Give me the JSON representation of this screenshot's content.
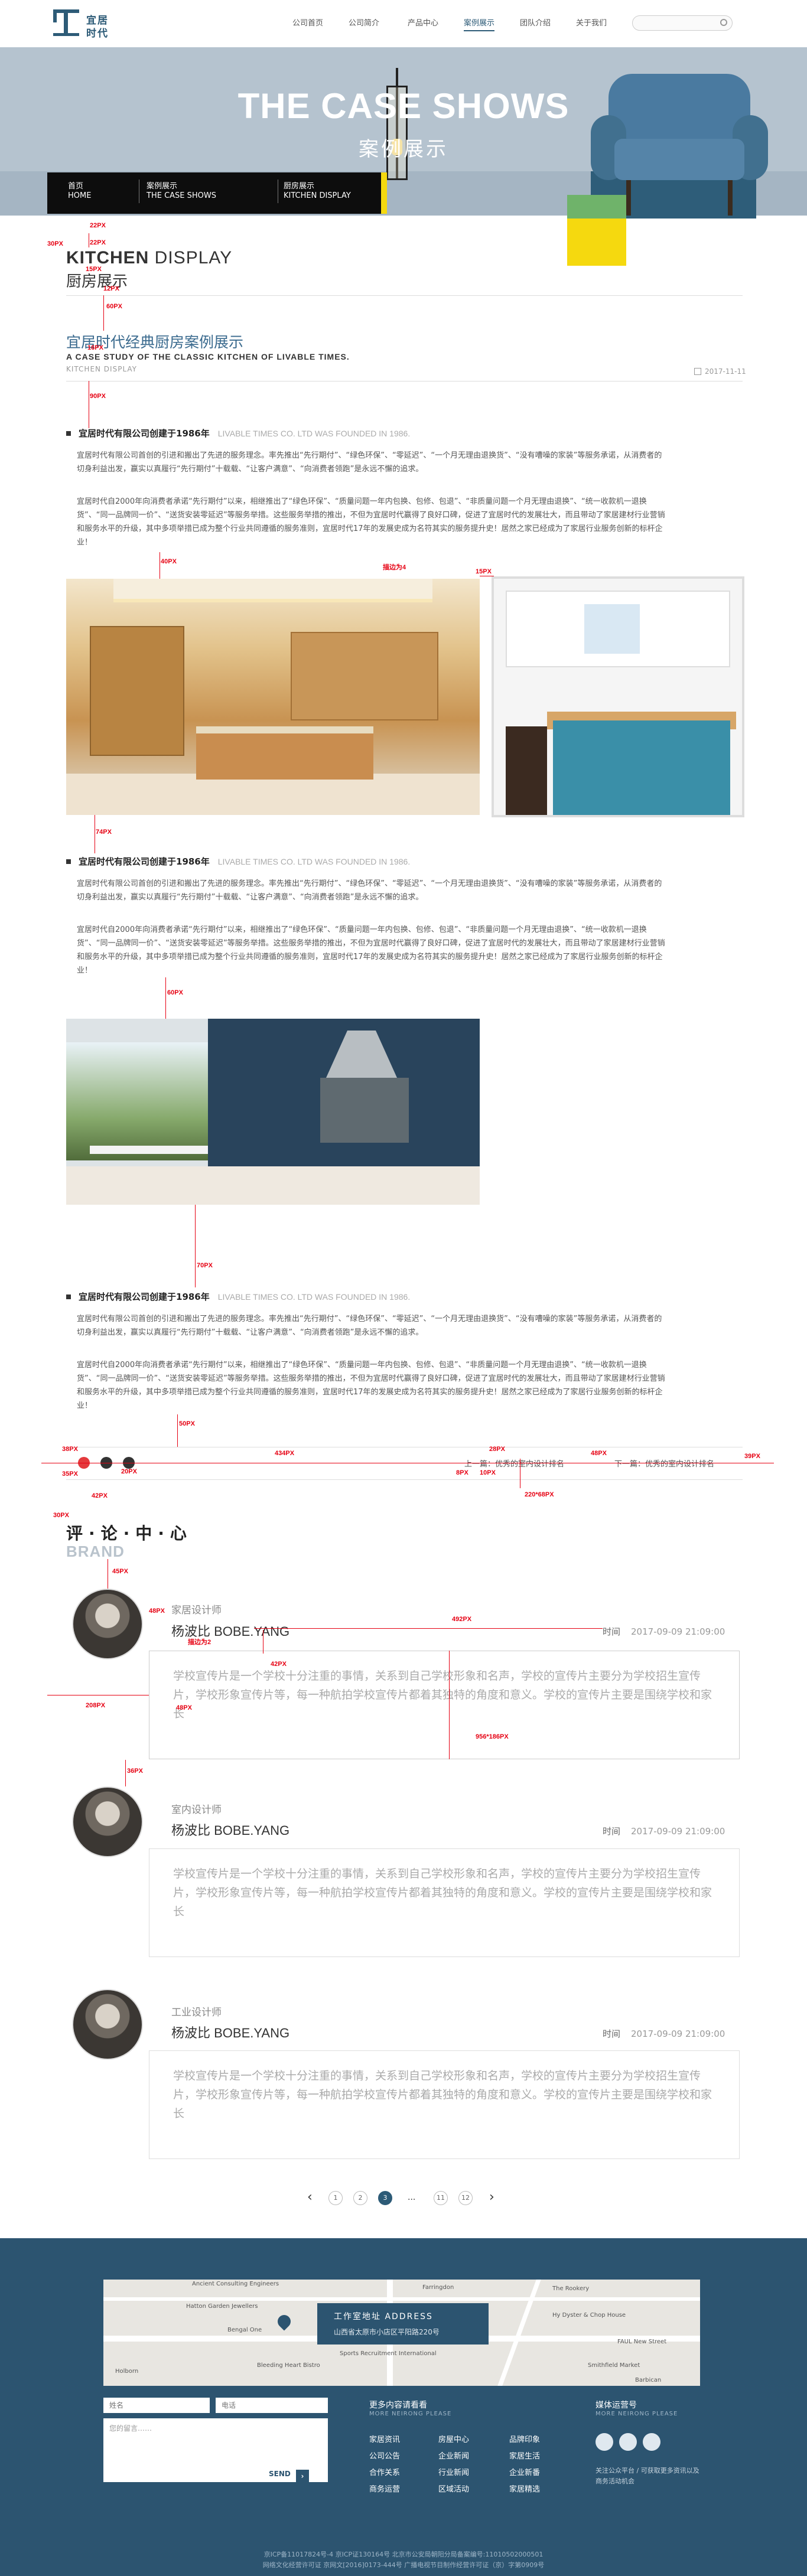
{
  "header": {
    "logo_line1": "宜居",
    "logo_line2": "时代",
    "nav": [
      "公司首页",
      "公司简介",
      "产品中心",
      "案例展示",
      "团队介绍",
      "关于我们"
    ],
    "search_placeholder": ""
  },
  "banner": {
    "title_en": "THE CASE SHOWS",
    "title_cn": "案例展示"
  },
  "breadcrumb": [
    {
      "cn": "首页",
      "en": "HOME"
    },
    {
      "cn": "案例展示",
      "en": "THE CASE SHOWS"
    },
    {
      "cn": "厨房展示",
      "en": "KITCHEN DISPLAY"
    }
  ],
  "section": {
    "title_bold": "KITCHEN",
    "title_light": " DISPLAY",
    "title_cn": "厨房展示"
  },
  "article": {
    "title": "宜居时代经典厨房案例展示",
    "subtitle": "A CASE STUDY OF THE CLASSIC KITCHEN OF LIVABLE TIMES.",
    "subtitle2": "KITCHEN DISPLAY",
    "date": "2017-11-11"
  },
  "blocks": [
    {
      "head": "宜居时代有限公司创建于1986年",
      "head_en": "LIVABLE TIMES CO. LTD WAS FOUNDED IN 1986.",
      "p1": "宜居时代有限公司首创的引进和搬出了先进的服务理念。率先推出“先行期付”、“绿色环保”、“零延迟”、“一个月无理由退换货”、“没有嘈噪的家装”等服务承诺，从消费者的切身利益出发，赢实以真履行“先行期付”十载载、“让客户满意”、“向消费者领跑”是永远不懈的追求。",
      "p2": "宜居时代自2000年向消费者承诺“先行期付”以来，相继推出了“绿色环保”、“质量问题一年内包换、包修、包退”、“非质量问题一个月无理由退换”、“统一收款机一退换货”、“同一品牌同一价”、“送货安装零延迟”等服务举措。这些服务举措的推出，不但为宜居时代赢得了良好口碑，促进了宜居时代的发展壮大，而且带动了家居建材行业营销和服务水平的升级，其中多项举措已成为整个行业共同遵循的服务准则，宜居时代17年的发展史成为名符其实的服务提升史！居然之家已经成为了家居行业服务创新的标杆企业！"
    },
    {
      "head": "宜居时代有限公司创建于1986年",
      "head_en": "LIVABLE TIMES CO. LTD WAS FOUNDED IN 1986.",
      "p1": "宜居时代有限公司首创的引进和搬出了先进的服务理念。率先推出“先行期付”、“绿色环保”、“零延迟”、“一个月无理由退换货”、“没有嘈噪的家装”等服务承诺，从消费者的切身利益出发，赢实以真履行“先行期付”十载载、“让客户满意”、“向消费者领跑”是永远不懈的追求。",
      "p2": "宜居时代自2000年向消费者承诺“先行期付”以来，相继推出了“绿色环保”、“质量问题一年内包换、包修、包退”、“非质量问题一个月无理由退换”、“统一收款机一退换货”、“同一品牌同一价”、“送货安装零延迟”等服务举措。这些服务举措的推出，不但为宜居时代赢得了良好口碑，促进了宜居时代的发展壮大，而且带动了家居建材行业营销和服务水平的升级，其中多项举措已成为整个行业共同遵循的服务准则，宜居时代17年的发展史成为名符其实的服务提升史！居然之家已经成为了家居行业服务创新的标杆企业！"
    },
    {
      "head": "宜居时代有限公司创建于1986年",
      "head_en": "LIVABLE TIMES CO. LTD WAS FOUNDED IN 1986.",
      "p1": "宜居时代有限公司首创的引进和搬出了先进的服务理念。率先推出“先行期付”、“绿色环保”、“零延迟”、“一个月无理由退换货”、“没有嘈噪的家装”等服务承诺，从消费者的切身利益出发，赢实以真履行“先行期付”十载载、“让客户满意”、“向消费者领跑”是永远不懈的追求。",
      "p2": "宜居时代自2000年向消费者承诺“先行期付”以来，相继推出了“绿色环保”、“质量问题一年内包换、包修、包退”、“非质量问题一个月无理由退换”、“统一收款机一退换货”、“同一品牌同一价”、“送货安装零延迟”等服务举措。这些服务举措的推出，不但为宜居时代赢得了良好口碑，促进了宜居时代的发展壮大，而且带动了家居建材行业营销和服务水平的升级，其中多项举措已成为整个行业共同遵循的服务准则，宜居时代17年的发展史成为名符其实的服务提升史！居然之家已经成为了家居行业服务创新的标杆企业！"
    }
  ],
  "annotations": [
    "22PX",
    "30PX",
    "22PX",
    "15PX",
    "12PX",
    "60PX",
    "16PX",
    "90PX",
    "40PX",
    "描边为4",
    "15PX",
    "74PX",
    "60PX",
    "70PX",
    "50PX",
    "38PX",
    "434PX",
    "28PX",
    "48PX",
    "39PX",
    "35PX",
    "20PX",
    "8PX",
    "10PX",
    "220*68PX",
    "30PX",
    "42PX",
    "45PX",
    "48PX",
    "492PX",
    "描边为2",
    "42PX",
    "208PX",
    "48PX",
    "956*186PX",
    "36PX"
  ],
  "share": {
    "prev": "上一篇：优秀的室内设计排名",
    "next": "下一篇：优秀的室内设计排名"
  },
  "comments_section": {
    "title_cn": "评·论·中·心",
    "title_en": "BRAND"
  },
  "comments": [
    {
      "role": "家居设计师",
      "name": "杨波比 BOBE.YANG",
      "time_label": "时间",
      "time": "2017-09-09 21:09:00",
      "text": "学校宣传片是一个学校十分注重的事情，关系到自己学校形象和名声，学校的宣传片主要分为学校招生宣传片，学校形象宣传片等，每一种航拍学校宣传片都着其独特的角度和意义。学校的宣传片主要是围绕学校和家长"
    },
    {
      "role": "室内设计师",
      "name": "杨波比 BOBE.YANG",
      "time_label": "时间",
      "time": "2017-09-09 21:09:00",
      "text": "学校宣传片是一个学校十分注重的事情，关系到自己学校形象和名声，学校的宣传片主要分为学校招生宣传片，学校形象宣传片等，每一种航拍学校宣传片都着其独特的角度和意义。学校的宣传片主要是围绕学校和家长"
    },
    {
      "role": "工业设计师",
      "name": "杨波比 BOBE.YANG",
      "time_label": "时间",
      "time": "2017-09-09 21:09:00",
      "text": "学校宣传片是一个学校十分注重的事情，关系到自己学校形象和名声，学校的宣传片主要分为学校招生宣传片，学校形象宣传片等，每一种航拍学校宣传片都着其独特的角度和意义。学校的宣传片主要是围绕学校和家长"
    }
  ],
  "pager": {
    "prev": "‹",
    "pages": [
      "1",
      "2",
      "3",
      "...",
      "11",
      "12"
    ],
    "next": "›",
    "current": "3"
  },
  "footer": {
    "map_labels": [
      "Farringdon",
      "The Rookery",
      "Hy Dyster & Chop House",
      "Smithfield Market",
      "Ancient Consulting Engineers",
      "Hatton Garden Jewellers",
      "Bengal One",
      "Holborn",
      "FAUL New Street",
      "Barbican",
      "Sports Recruitment International",
      "Bleeding Heart Bistro"
    ],
    "address_title": "工作室地址 ADDRESS",
    "address": "山西省太原市小店区平阳路220号",
    "name_placeholder": "姓名",
    "phone_placeholder": "电话",
    "msg_placeholder": "您的留言……",
    "send": "SEND",
    "col1_title": "更多内容请看看",
    "col1_sub": "MORE NEIRONG PLEASE",
    "col1_links": [
      [
        "家居资讯",
        "房屋中心",
        "品牌印象"
      ],
      [
        "公司公告",
        "企业新闻",
        "家居生活"
      ],
      [
        "合作关系",
        "行业新闻",
        "企业新番"
      ],
      [
        "商务运营",
        "区域活动",
        "家居精选"
      ]
    ],
    "col2_title": "媒体运营号",
    "col2_sub": "MORE NEIRONG PLEASE",
    "col2_note": "关注公众平台 / 可获取更多资讯以及商务活动机会",
    "copy1": "京ICP备11017824号-4 京ICP证130164号 北京市公安局朝阳分局备案编号:11010502000501",
    "copy2": "网络文化经营许可证 京网文[2016]0173-444号 广播电视节目制作经营许可证（京）字第0909号"
  }
}
